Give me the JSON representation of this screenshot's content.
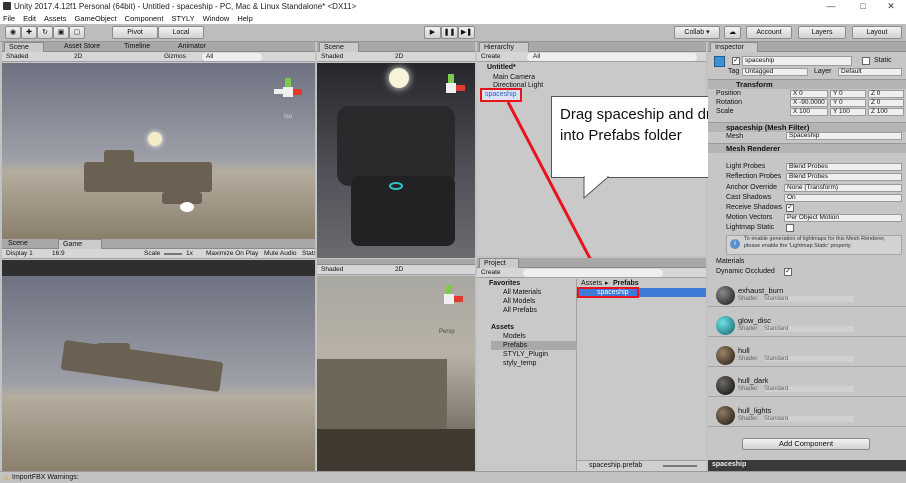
{
  "window": {
    "title": "Unity 2017.4.12f1 Personal (64bit) - Untitled - spaceship - PC, Mac & Linux Standalone* <DX11>",
    "minimize": "—",
    "maximize": "□",
    "close": "✕"
  },
  "menu": [
    "File",
    "Edit",
    "Assets",
    "GameObject",
    "Component",
    "STYLY",
    "Window",
    "Help"
  ],
  "toolbar": {
    "pivot": "Pivot",
    "local": "Local",
    "collab": "Collab ▾",
    "account": "Account",
    "layers": "Layers",
    "layout": "Layout"
  },
  "scene_panel": {
    "tabs": [
      "Scene",
      "Asset Store",
      "Timeline",
      "Animator"
    ],
    "shaded": "Shaded",
    "mode_2d": "2D",
    "gizmos": "Gizmos",
    "search_placeholder": "All",
    "gizmo_label": "Iso"
  },
  "game_panel": {
    "tabs": [
      "Scene",
      "Game"
    ],
    "display": "Display 1",
    "aspect": "16:9",
    "scale_label": "Scale",
    "scale_value": "1x",
    "maximize": "Maximize On Play",
    "mute": "Mute Audio",
    "stats": "Stats"
  },
  "scene2_panel": {
    "tab": "Scene",
    "shaded": "Shaded",
    "mode_2d": "2D"
  },
  "scene3_panel": {
    "shaded": "Shaded",
    "mode_2d": "2D",
    "gizmo_label": "Persp"
  },
  "hierarchy": {
    "tab": "Hierarchy",
    "create": "Create",
    "search_placeholder": "All",
    "scene": "Untitled*",
    "items": [
      "Main Camera",
      "Directional Light",
      "spaceship"
    ]
  },
  "callout": {
    "text": "Drag spaceship and drop into Prefabs folder"
  },
  "project": {
    "tab": "Project",
    "create": "Create",
    "favorites_label": "Favorites",
    "favorites": [
      "All Materials",
      "All Models",
      "All Prefabs"
    ],
    "assets_label": "Assets",
    "assets": [
      "Models",
      "Prefabs",
      "STYLY_Plugin",
      "styly_temp"
    ],
    "breadcrumb_assets": "Assets",
    "breadcrumb_sep": "▸",
    "breadcrumb_current": "Prefabs",
    "file": "spaceship",
    "footer_file": "spaceship.prefab"
  },
  "inspector": {
    "tab": "Inspector",
    "name": "spaceship",
    "static": "Static",
    "tag_label": "Tag",
    "tag": "Untagged",
    "layer_label": "Layer",
    "layer": "Default",
    "transform_label": "Transform",
    "position_label": "Position",
    "rotation_label": "Rotation",
    "scale_label": "Scale",
    "position": [
      "X 0",
      "Y 0",
      "Z 0"
    ],
    "rotation": [
      "X -90.0000",
      "Y 0",
      "Z 0"
    ],
    "scale": [
      "X 100",
      "Y 100",
      "Z 100"
    ],
    "mesh_filter": "spaceship (Mesh Filter)",
    "mesh_label": "Mesh",
    "mesh_value": "Spaceship",
    "mesh_renderer": "Mesh Renderer",
    "light_probes_label": "Light Probes",
    "light_probes": "Blend Probes",
    "reflection_probes_label": "Reflection Probes",
    "reflection_probes": "Blend Probes",
    "anchor_label": "Anchor Override",
    "anchor_value": "None (Transform)",
    "cast_shadows_label": "Cast Shadows",
    "cast_shadows": "On",
    "receive_shadows_label": "Receive Shadows",
    "motion_vectors_label": "Motion Vectors",
    "motion_vectors": "Per Object Motion",
    "lightmap_static_label": "Lightmap Static",
    "info_text": "To enable generation of lightmaps for this Mesh Renderer, please enable the 'Lightmap Static' property.",
    "materials_label": "Materials",
    "dynamic_occluded_label": "Dynamic Occluded",
    "shader_label": "Shader",
    "shader_value": "Standard",
    "materials": [
      "exhaust_burn",
      "glow_disc",
      "hull",
      "hull_dark",
      "hull_lights"
    ],
    "add_component": "Add Component",
    "footer": "spaceship"
  },
  "statusbar": {
    "text": "ImportFBX Warnings:"
  },
  "colors": {
    "highlight": "#3d7bd9",
    "annotation_red": "#e8131d",
    "selection_text": "#2f5fc8"
  },
  "icons": [
    "play-icon",
    "pause-icon",
    "step-icon",
    "hand-tool-icon",
    "move-tool-icon",
    "rotate-tool-icon",
    "scale-tool-icon",
    "rect-tool-icon",
    "cloud-icon",
    "folder-icon",
    "sun-icon",
    "scene-gizmo-icon"
  ]
}
